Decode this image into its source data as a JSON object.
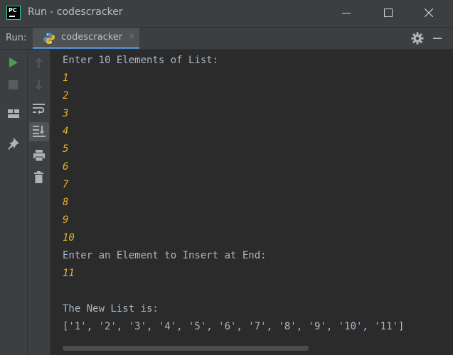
{
  "window": {
    "title": "Run - codescracker",
    "logo_text": "PC"
  },
  "runbar": {
    "label": "Run:",
    "tab_label": "codescracker",
    "tab_close": "×"
  },
  "icons": {
    "run": "play-icon",
    "stop": "stop-icon",
    "layout": "layout-icon",
    "pin": "pin-icon",
    "up": "arrow-up-icon",
    "down": "arrow-down-icon",
    "soft_wrap": "soft-wrap-icon",
    "scroll_to_end": "scroll-to-end-icon",
    "print": "print-icon",
    "trash": "trash-icon",
    "settings": "gear-icon",
    "hide": "hide-icon"
  },
  "colors": {
    "output_text": "#a9b7c6",
    "user_input": "#e8b323",
    "run_green": "#499c54",
    "tab_underline": "#4a88c7"
  },
  "console": {
    "lines": [
      {
        "text": "Enter 10 Elements of List:",
        "type": "output"
      },
      {
        "text": "1",
        "type": "input"
      },
      {
        "text": "2",
        "type": "input"
      },
      {
        "text": "3",
        "type": "input"
      },
      {
        "text": "4",
        "type": "input"
      },
      {
        "text": "5",
        "type": "input"
      },
      {
        "text": "6",
        "type": "input"
      },
      {
        "text": "7",
        "type": "input"
      },
      {
        "text": "8",
        "type": "input"
      },
      {
        "text": "9",
        "type": "input"
      },
      {
        "text": "10",
        "type": "input"
      },
      {
        "text": "Enter an Element to Insert at End:",
        "type": "output"
      },
      {
        "text": "11",
        "type": "input"
      },
      {
        "text": "",
        "type": "output"
      },
      {
        "text": "The New List is:",
        "type": "output"
      },
      {
        "text": "['1', '2', '3', '4', '5', '6', '7', '8', '9', '10', '11']",
        "type": "output"
      }
    ]
  }
}
